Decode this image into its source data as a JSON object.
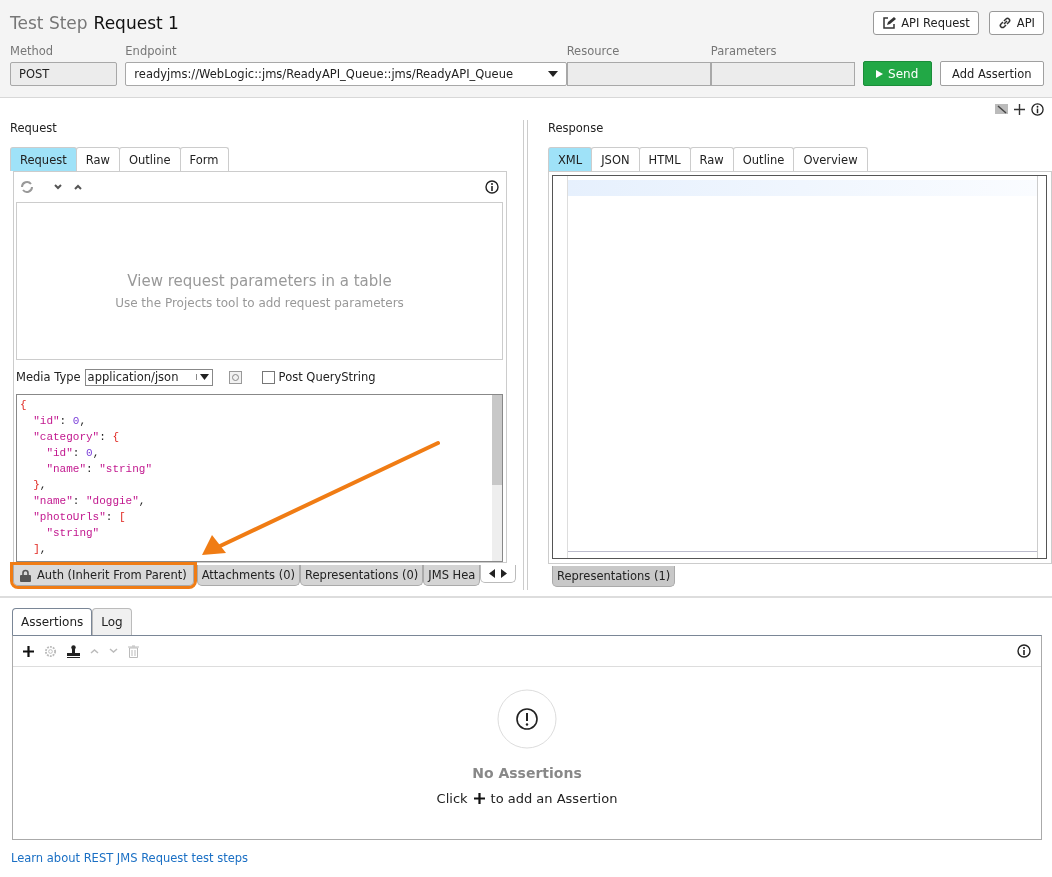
{
  "header": {
    "caption": "Test Step",
    "title": "Request 1",
    "buttons": [
      {
        "label": "API Request",
        "kind": "edit"
      },
      {
        "label": "API",
        "kind": "link"
      }
    ]
  },
  "fields": [
    {
      "label": "Method",
      "value": "POST",
      "kind": "text"
    },
    {
      "label": "Endpoint",
      "value": "readyjms://WebLogic::jms/ReadyAPI_Queue::jms/ReadyAPI_Queue",
      "kind": "dropdown"
    },
    {
      "label": "Resource",
      "kind": "text"
    },
    {
      "label": "Parameters",
      "kind": "text"
    }
  ],
  "actions": {
    "send": "Send",
    "add_assertion": "Add Assertion"
  },
  "request": {
    "title": "Request",
    "tabs": [
      {
        "label": "Request",
        "selected": true
      },
      {
        "label": "Raw",
        "selected": false
      },
      {
        "label": "Outline",
        "selected": false
      },
      {
        "label": "Form",
        "selected": false
      }
    ],
    "empty_title": "View request parameters in a table",
    "empty_hint": "Use the Projects tool to add request parameters",
    "media_type_label": "Media Type",
    "media_type": "application/json",
    "post_querystring": {
      "label": "Post QueryString",
      "checked": false
    },
    "code_lines": [
      [
        {
          "text": "{",
          "kind": "brace"
        }
      ],
      [
        {
          "text": "  \"id\"",
          "kind": "key"
        },
        {
          "text": ": ",
          "kind": "punct"
        },
        {
          "text": "0",
          "kind": "number"
        },
        {
          "text": ",",
          "kind": "punct"
        }
      ],
      [
        {
          "text": "  \"category\"",
          "kind": "key"
        },
        {
          "text": ": ",
          "kind": "punct"
        },
        {
          "text": "{",
          "kind": "brace"
        }
      ],
      [
        {
          "text": "    \"id\"",
          "kind": "key"
        },
        {
          "text": ": ",
          "kind": "punct"
        },
        {
          "text": "0",
          "kind": "number"
        },
        {
          "text": ",",
          "kind": "punct"
        }
      ],
      [
        {
          "text": "    \"name\"",
          "kind": "key"
        },
        {
          "text": ": ",
          "kind": "punct"
        },
        {
          "text": "\"string\"",
          "kind": "string"
        }
      ],
      [
        {
          "text": "  }",
          "kind": "brace"
        },
        {
          "text": ",",
          "kind": "punct"
        }
      ],
      [
        {
          "text": "  \"name\"",
          "kind": "key"
        },
        {
          "text": ": ",
          "kind": "punct"
        },
        {
          "text": "\"doggie\"",
          "kind": "string"
        },
        {
          "text": ",",
          "kind": "punct"
        }
      ],
      [
        {
          "text": "  \"photoUrls\"",
          "kind": "key"
        },
        {
          "text": ": ",
          "kind": "punct"
        },
        {
          "text": "[",
          "kind": "brace"
        }
      ],
      [
        {
          "text": "    \"string\"",
          "kind": "string"
        }
      ],
      [
        {
          "text": "  ]",
          "kind": "brace"
        },
        {
          "text": ",",
          "kind": "punct"
        }
      ]
    ],
    "bottom_tabs": [
      {
        "label": "Auth (Inherit From Parent)",
        "kind": "auth",
        "highlighted": true
      },
      {
        "label": "Attachments (0)",
        "kind": "plain",
        "highlighted": false
      },
      {
        "label": "Representations (0)",
        "kind": "plain",
        "highlighted": false
      },
      {
        "label": "JMS Hea",
        "kind": "plain",
        "highlighted": false
      }
    ]
  },
  "response": {
    "title": "Response",
    "tabs": [
      {
        "label": "XML",
        "selected": true
      },
      {
        "label": "JSON",
        "selected": false
      },
      {
        "label": "HTML",
        "selected": false
      },
      {
        "label": "Raw",
        "selected": false
      },
      {
        "label": "Outline",
        "selected": false
      },
      {
        "label": "Overview",
        "selected": false
      }
    ],
    "bottom_tabs": [
      {
        "label": "Representations (1)"
      }
    ]
  },
  "assertions": {
    "tabs": [
      {
        "label": "Assertions",
        "selected": true
      },
      {
        "label": "Log",
        "selected": false
      }
    ],
    "empty_title": "No Assertions",
    "hint_before": "Click",
    "hint_after": "to add an Assertion"
  },
  "footer_link": "Learn about REST JMS Request test steps"
}
